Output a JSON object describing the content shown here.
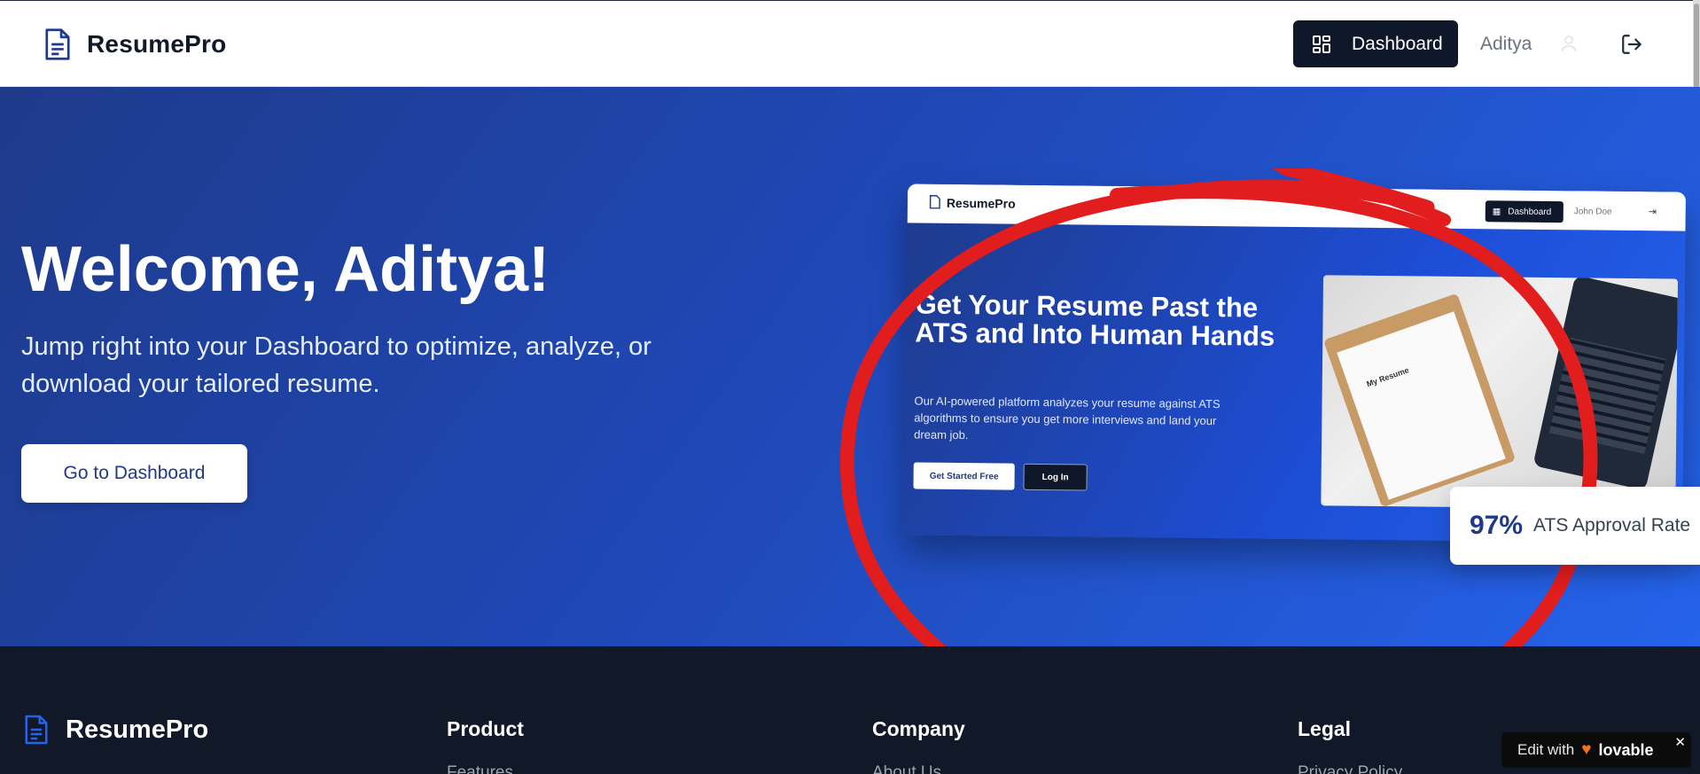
{
  "header": {
    "brand": "ResumePro",
    "dashboard_button": "Dashboard",
    "user_name": "Aditya"
  },
  "hero": {
    "title": "Welcome, Aditya!",
    "subtitle": "Jump right into your Dashboard to optimize, analyze, or download your tailored resume.",
    "cta": "Go to Dashboard"
  },
  "preview": {
    "brand": "ResumePro",
    "dashboard_button": "Dashboard",
    "user_name": "John Doe",
    "title": "Get Your Resume Past the ATS and Into Human Hands",
    "text": "Our AI-powered platform analyzes your resume against ATS algorithms to ensure you get more interviews and land your dream job.",
    "primary_button": "Get Started Free",
    "secondary_button": "Log In",
    "paper_label": "My Resume"
  },
  "stat": {
    "value": "97%",
    "label": "ATS Approval Rate"
  },
  "footer": {
    "brand": "ResumePro",
    "columns": [
      "Product",
      "Company",
      "Legal"
    ],
    "links": [
      "Features",
      "About Us",
      "Privacy Policy"
    ]
  },
  "lovable_badge": {
    "prefix": "Edit with",
    "name": "lovable",
    "close": "✕"
  },
  "colors": {
    "header_bg": "#ffffff",
    "hero_gradient_start": "#1e3a8a",
    "hero_gradient_end": "#2563eb",
    "footer_bg": "#111827",
    "annotation": "#e11d1d",
    "primary_dark": "#0f172a"
  }
}
